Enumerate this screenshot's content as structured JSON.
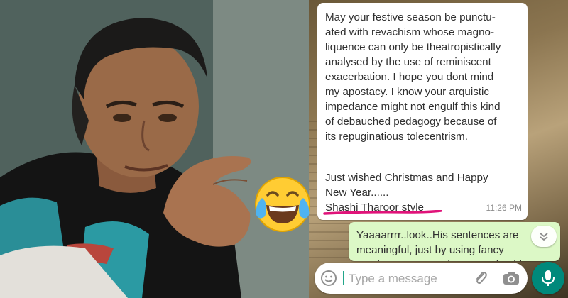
{
  "chat": {
    "incoming_message": {
      "body": "May your festive season be punctu-\nated with revachism whose magno-\nliquence can only be theatropistically\nanalysed by the use of reminiscent\nexacerbation. I hope you dont mind\nmy apostacy. I know your arquistic\nimpedance might not engulf this kind\nof debauched pedagogy because of\nits repuginatious tolecentrism.",
      "sign_off": "Just wished Christmas and Happy\nNew Year......\nShashi Tharoor style",
      "time": "11:26 PM"
    },
    "outgoing_message": {
      "body": "Yaaaarrrr..look..His sentences are\nmeaningful, just by using fancy\nwords..no one can become Shashi"
    },
    "composer": {
      "placeholder": "Type a message"
    }
  },
  "icons": {
    "emoji_button": "smiley-icon",
    "attach": "paperclip-icon",
    "camera": "camera-icon",
    "mic": "mic-icon",
    "scroll": "chevron-down-icon",
    "overlay_emoji": "face-with-tears-of-joy-emoji"
  },
  "colors": {
    "incoming_bubble": "#ffffff",
    "outgoing_bubble": "#dcf8c6",
    "mic_button": "#00897b",
    "underline_mark": "#e0147a",
    "caret": "#22a68a"
  }
}
